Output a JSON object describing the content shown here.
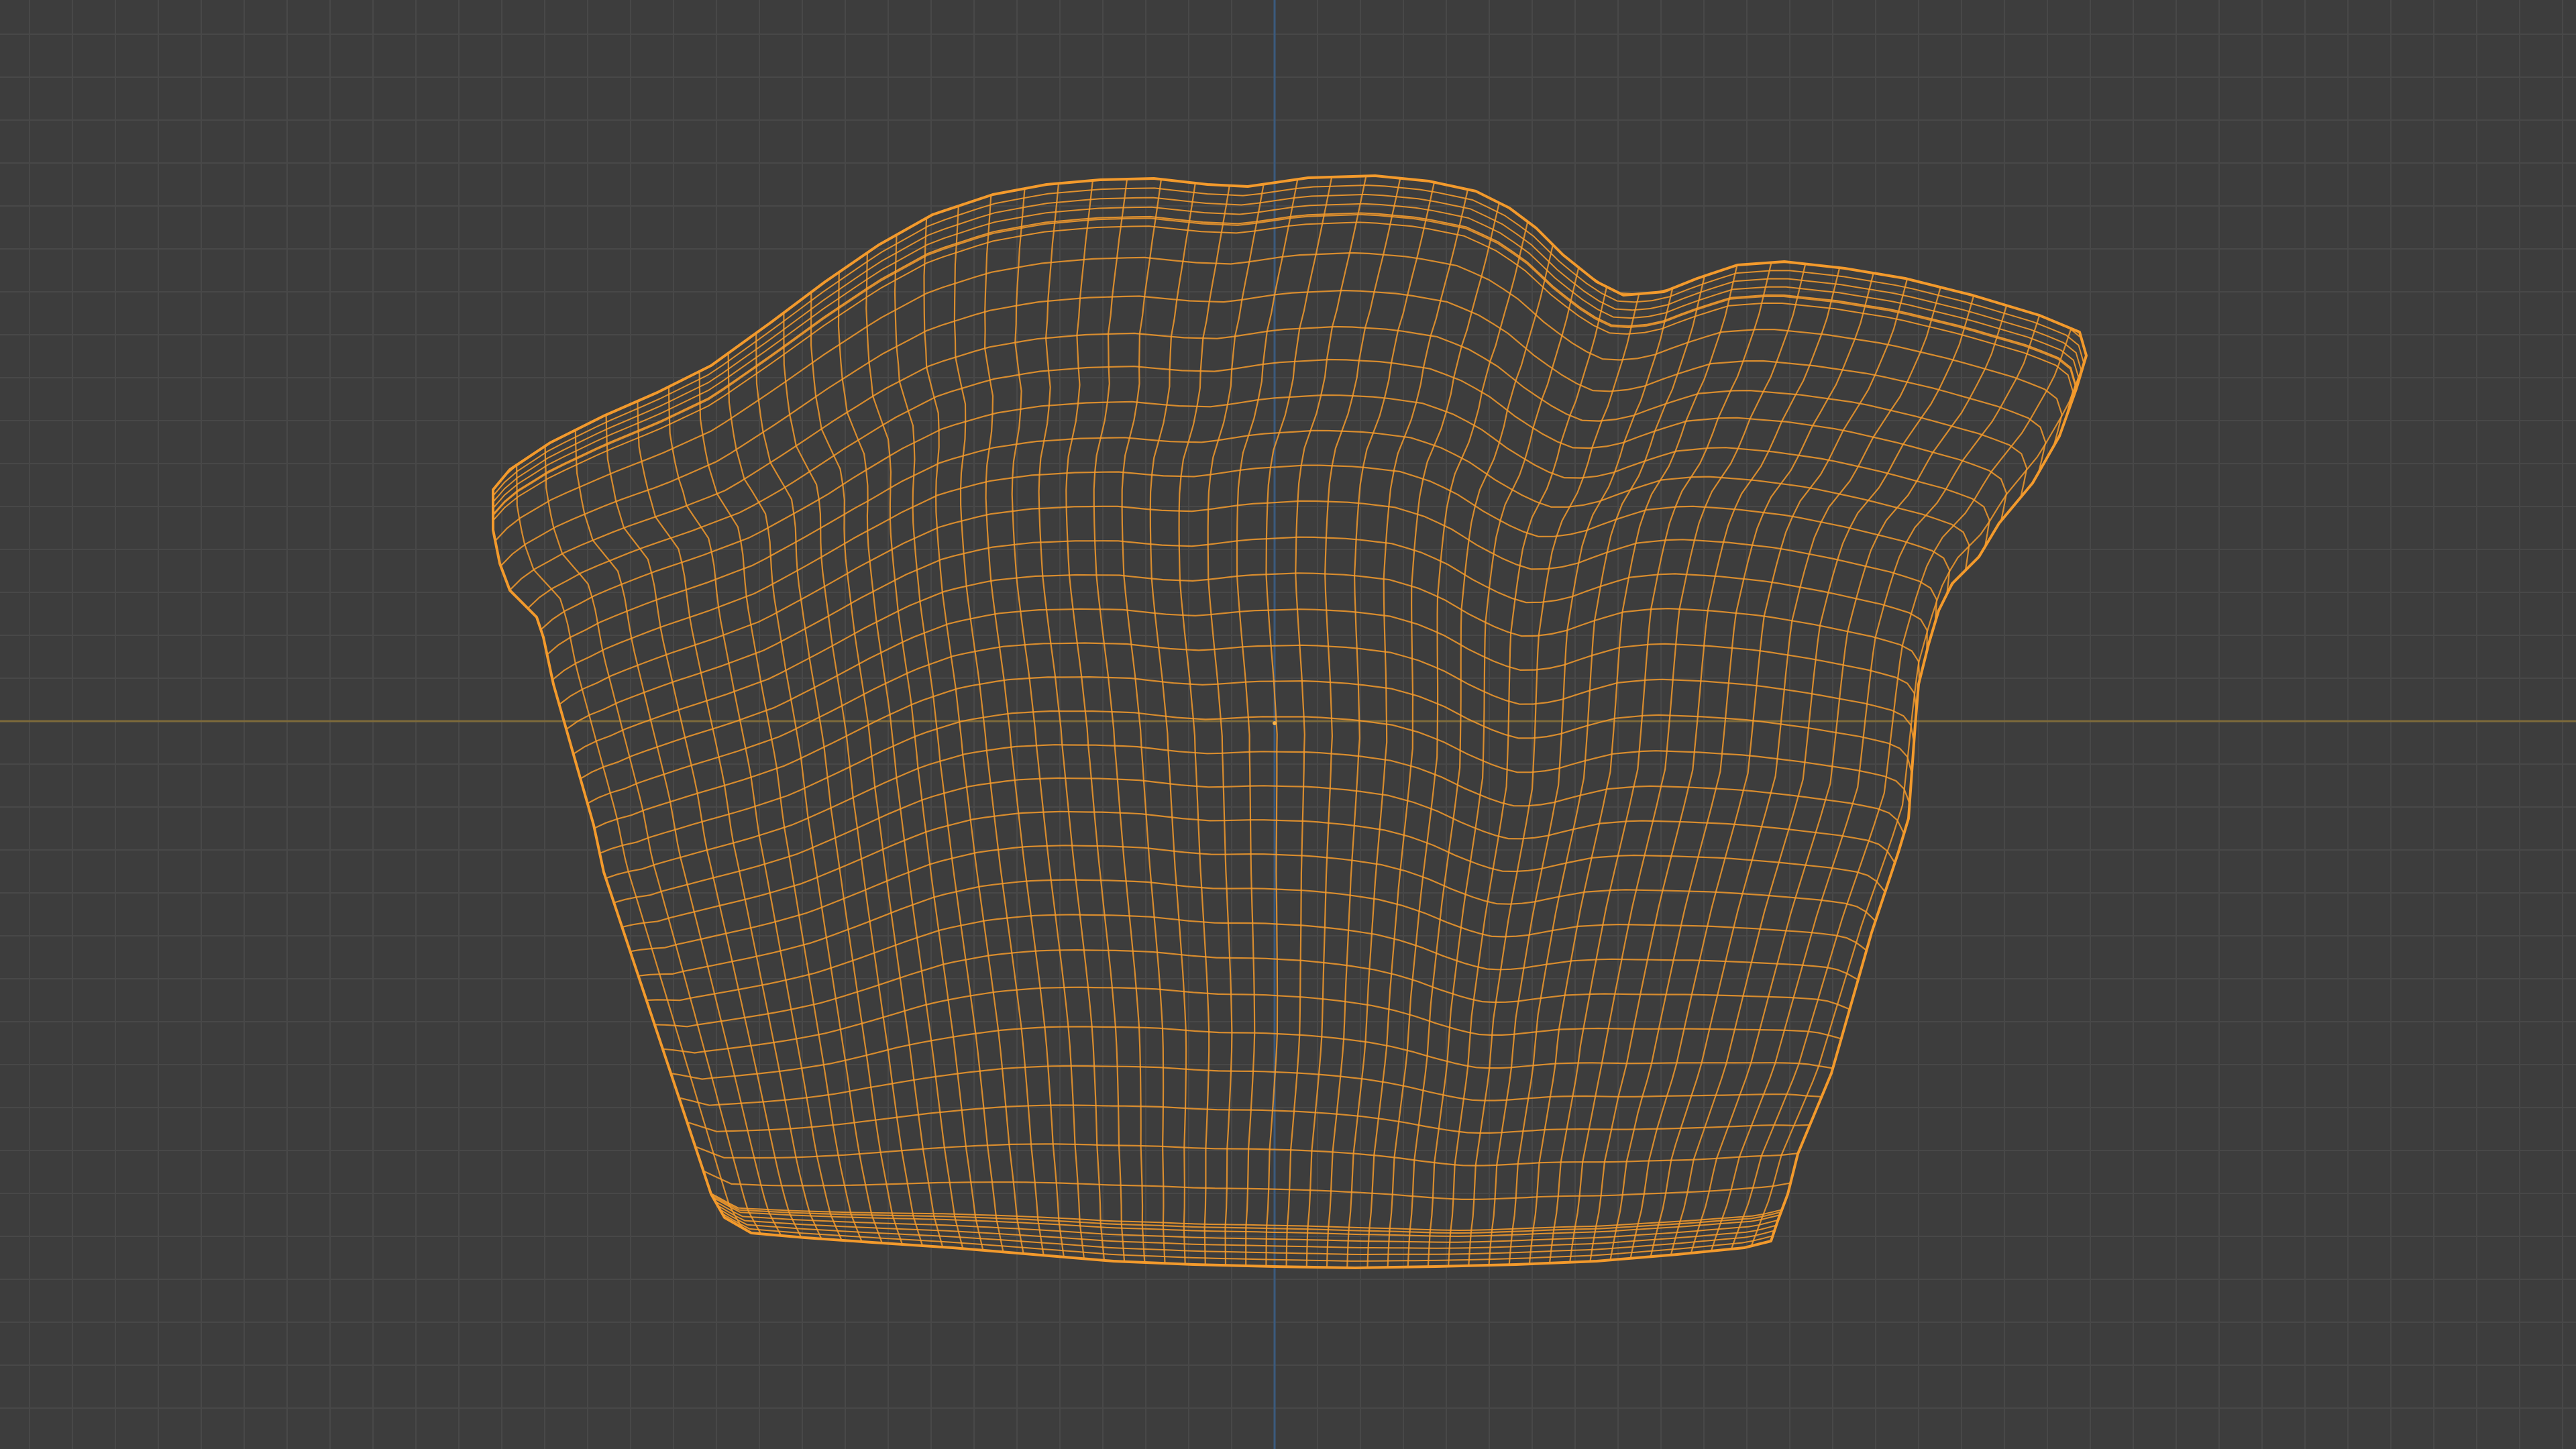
{
  "viewport": {
    "view_type": "3D viewport (orthographic front view, wireframe)",
    "background_color": "#3d3d3d",
    "grid_color": "#484848",
    "x_axis_color": "#7d6a3b",
    "z_axis_color": "#3b5a7d",
    "selection_color": "#f39a2c",
    "origin_marker_color": "#f6b24a"
  },
  "object": {
    "name_visible": false,
    "display_mode": "wireframe",
    "selected": true,
    "shape_description_icon": "mesh-icon"
  }
}
